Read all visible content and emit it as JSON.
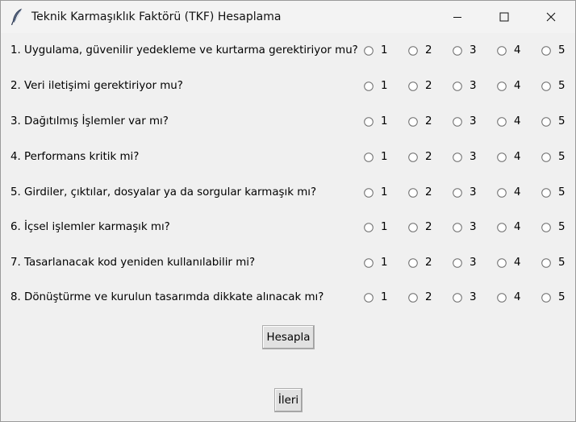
{
  "window": {
    "title": "Teknik Karmaşıklık Faktörü (TKF) Hesaplama",
    "app_icon": "feather-icon",
    "controls": [
      "minimize-icon",
      "maximize-icon",
      "close-icon"
    ]
  },
  "questions": [
    {
      "text": "1. Uygulama, güvenilir yedekleme ve kurtarma gerektiriyor mu?"
    },
    {
      "text": "2. Veri iletişimi gerektiriyor mu?"
    },
    {
      "text": "3. Dağıtılmış İşlemler var mı?"
    },
    {
      "text": "4. Performans kritik mi?"
    },
    {
      "text": "5. Girdiler, çıktılar, dosyalar ya da sorgular karmaşık mı?"
    },
    {
      "text": "6. İçsel işlemler karmaşık mı?"
    },
    {
      "text": "7. Tasarlanacak kod yeniden kullanılabilir mi?"
    },
    {
      "text": "8. Dönüştürme ve kurulun tasarımda dikkate alınacak mı?"
    }
  ],
  "options": [
    "1",
    "2",
    "3",
    "4",
    "5"
  ],
  "buttons": {
    "calculate": "Hesapla",
    "next": "İleri"
  }
}
